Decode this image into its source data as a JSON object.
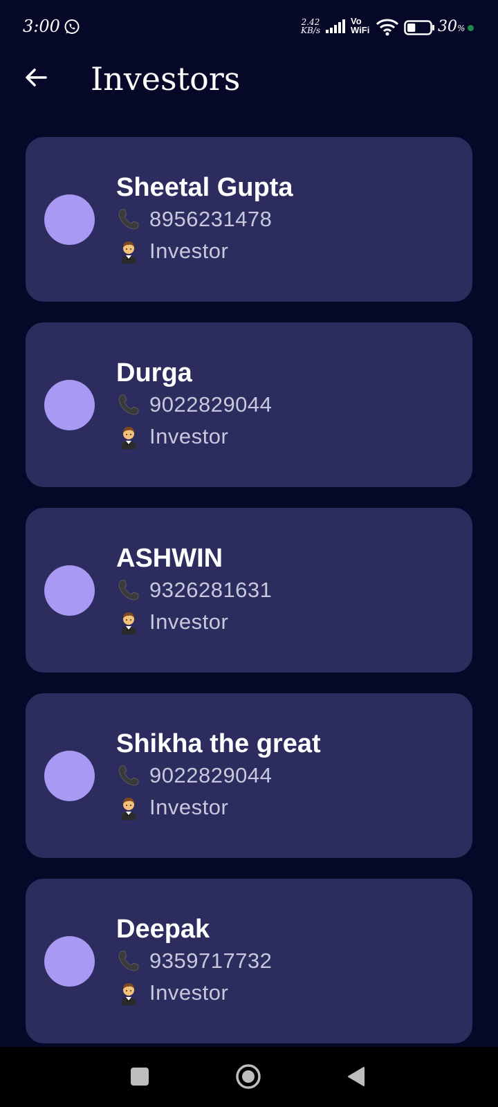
{
  "status_bar": {
    "time": "3:00",
    "net_speed_value": "2.42",
    "net_speed_unit": "KB/s",
    "vowifi_top": "Vo",
    "vowifi_bottom": "WiFi",
    "battery_percent": "30",
    "battery_unit": "%",
    "battery_level": 0.3,
    "icons": [
      "whatsapp-icon",
      "signal-icon",
      "wifi-icon",
      "battery-icon"
    ]
  },
  "header": {
    "title": "Investors",
    "back_icon": "arrow-left-icon"
  },
  "investors": [
    {
      "name": "Sheetal Gupta",
      "phone": "8956231478",
      "role": "Investor"
    },
    {
      "name": "Durga",
      "phone": "9022829044",
      "role": "Investor"
    },
    {
      "name": "ASHWIN",
      "phone": "9326281631",
      "role": "Investor"
    },
    {
      "name": "Shikha the great",
      "phone": "9022829044",
      "role": "Investor"
    },
    {
      "name": "Deepak",
      "phone": "9359717732",
      "role": "Investor"
    }
  ],
  "colors": {
    "background": "#050826",
    "card": "#2c2d5e",
    "avatar": "#a899f2",
    "secondary_text": "#c6c8dd"
  },
  "nav_bar": {
    "icons": [
      "recents-icon",
      "home-icon",
      "back-icon"
    ]
  }
}
